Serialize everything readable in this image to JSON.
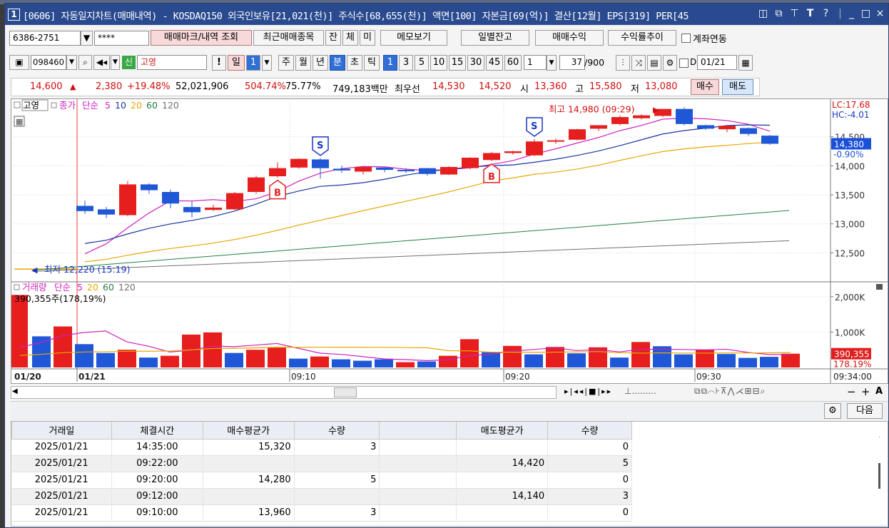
{
  "window": {
    "number": "1",
    "title": "[0606] 자동일지차트(매매내역) - KOSDAQ150 외국인보유[21,021(천)] 주식수[68,655(천)] 액면[100] 자본금[69(억)] 결산[12월] EPS[319] PER[45",
    "controls": [
      "restore",
      "pin",
      "font",
      "help",
      "minimize",
      "maximize",
      "close"
    ]
  },
  "toolbar1": {
    "account": "6386-2751",
    "password": "****",
    "btn_mark": "매매마크/내역 조회",
    "btn_recent": "최근매매종목",
    "btn_jan": "잔",
    "btn_che": "체",
    "btn_mi": "미",
    "btn_memo": "메모보기",
    "btn_daily": "일별잔고",
    "btn_profit": "매매수익",
    "btn_rate": "수익률추이",
    "chk_account": "계좌연동"
  },
  "toolbar2": {
    "code": "098460",
    "badge": "신",
    "stock_name": "고영",
    "periods": [
      "일",
      "1",
      "주",
      "월",
      "년",
      "분",
      "초",
      "틱"
    ],
    "active_period": "분",
    "minutes": [
      "1",
      "3",
      "5",
      "10",
      "15",
      "30",
      "45",
      "60"
    ],
    "active_minute": "1",
    "interval_value": "1",
    "count_value": "37",
    "count_total": "/900",
    "date_value": "01/21",
    "date_checkbox_label": "D"
  },
  "price_bar": {
    "price": "14,600",
    "change": "2,380",
    "change_pct": "+19.48%",
    "volume": "52,021,906",
    "vol_ratio": "504.74%",
    "turnover": "75.77%",
    "amount": "749,183백만",
    "best_label": "최우선",
    "ask": "14,530",
    "bid": "14,520",
    "open_label": "시",
    "open": "13,360",
    "high_label": "고",
    "high": "15,580",
    "low_label": "저",
    "low": "13,080",
    "buy": "매수",
    "sell": "매도"
  },
  "chart_data": [
    {
      "type": "candlestick",
      "title": "고영",
      "legend": [
        "종가",
        "단순",
        "5",
        "10",
        "20",
        "60",
        "120"
      ],
      "legend_colors": [
        "#d020c0",
        "#d020c0",
        "#d020c0",
        "#1a35a0",
        "#e8a800",
        "#208040",
        "#707070"
      ],
      "yticks": [
        "14,500",
        "14,000",
        "13,500",
        "13,000",
        "12,500"
      ],
      "ylim": [
        12050,
        15050
      ],
      "lc": "LC:17.68",
      "hc": "HC:-4.01",
      "current_price": "14,380",
      "current_pct": "-0.90%",
      "high_note": "최고 14,980 (09:29)",
      "low_note": "최저 12,220 (15:19)",
      "candles": [
        {
          "o": 13310,
          "c": 13220,
          "h": 13400,
          "l": 13170
        },
        {
          "o": 13250,
          "c": 13160,
          "h": 13290,
          "l": 13100
        },
        {
          "o": 13150,
          "c": 13680,
          "h": 13740,
          "l": 13130
        },
        {
          "o": 13680,
          "c": 13580,
          "h": 13700,
          "l": 13520
        },
        {
          "o": 13550,
          "c": 13350,
          "h": 13590,
          "l": 13270
        },
        {
          "o": 13290,
          "c": 13200,
          "h": 13390,
          "l": 13110
        },
        {
          "o": 13240,
          "c": 13280,
          "h": 13330,
          "l": 13220
        },
        {
          "o": 13250,
          "c": 13530,
          "h": 13550,
          "l": 13240
        },
        {
          "o": 13550,
          "c": 13800,
          "h": 13830,
          "l": 13520
        },
        {
          "o": 13820,
          "c": 13960,
          "h": 14060,
          "l": 13800
        },
        {
          "o": 13970,
          "c": 14120,
          "h": 14130,
          "l": 13950
        },
        {
          "o": 14110,
          "c": 13960,
          "h": 14130,
          "l": 13780
        },
        {
          "o": 13950,
          "c": 13920,
          "h": 14000,
          "l": 13880
        },
        {
          "o": 13900,
          "c": 13980,
          "h": 13990,
          "l": 13850
        },
        {
          "o": 13970,
          "c": 13930,
          "h": 13980,
          "l": 13890
        },
        {
          "o": 13930,
          "c": 13920,
          "h": 13960,
          "l": 13880
        },
        {
          "o": 13960,
          "c": 13860,
          "h": 13960,
          "l": 13830
        },
        {
          "o": 13850,
          "c": 13980,
          "h": 13990,
          "l": 13840
        },
        {
          "o": 13960,
          "c": 14140,
          "h": 14150,
          "l": 13940
        },
        {
          "o": 14100,
          "c": 14220,
          "h": 14240,
          "l": 14080
        },
        {
          "o": 14220,
          "c": 14250,
          "h": 14260,
          "l": 14190
        },
        {
          "o": 14180,
          "c": 14420,
          "h": 14460,
          "l": 14170
        },
        {
          "o": 14420,
          "c": 14440,
          "h": 14470,
          "l": 14380
        },
        {
          "o": 14450,
          "c": 14630,
          "h": 14640,
          "l": 14440
        },
        {
          "o": 14640,
          "c": 14700,
          "h": 14700,
          "l": 14600
        },
        {
          "o": 14720,
          "c": 14840,
          "h": 14870,
          "l": 14700
        },
        {
          "o": 14820,
          "c": 14870,
          "h": 14890,
          "l": 14800
        },
        {
          "o": 14860,
          "c": 14980,
          "h": 14980,
          "l": 14840
        },
        {
          "o": 14980,
          "c": 14720,
          "h": 15010,
          "l": 14700
        },
        {
          "o": 14700,
          "c": 14640,
          "h": 14710,
          "l": 14620
        },
        {
          "o": 14630,
          "c": 14690,
          "h": 14700,
          "l": 14580
        },
        {
          "o": 14650,
          "c": 14550,
          "h": 14660,
          "l": 14520
        },
        {
          "o": 14520,
          "c": 14380,
          "h": 14530,
          "l": 14360
        }
      ],
      "trade_marks": [
        {
          "type": "B",
          "index": 9
        },
        {
          "type": "S",
          "index": 11
        },
        {
          "type": "B",
          "index": 19
        },
        {
          "type": "S",
          "index": 21
        }
      ]
    },
    {
      "type": "bar",
      "title": "거래량",
      "legend": [
        "거래량",
        "단순",
        "5",
        "20",
        "60",
        "120"
      ],
      "legend_colors": [
        "#d020c0",
        "#d020c0",
        "#d020c0",
        "#e8a800",
        "#208040",
        "#707070"
      ],
      "readout": "390,355주(178,19%)",
      "yticks": [
        "2,000K",
        "1,000K"
      ],
      "ylim": [
        0,
        2300
      ],
      "current_value": "390,355",
      "current_pct": "178.19%",
      "values": [
        2050,
        880,
        1160,
        660,
        410,
        500,
        280,
        330,
        930,
        990,
        410,
        500,
        560,
        250,
        310,
        230,
        190,
        230,
        150,
        170,
        330,
        800,
        430,
        610,
        370,
        580,
        400,
        570,
        280,
        720,
        600,
        370,
        510,
        380,
        270,
        300,
        390
      ],
      "up": [
        true,
        false,
        true,
        false,
        false,
        true,
        false,
        true,
        true,
        true,
        false,
        true,
        true,
        false,
        true,
        false,
        false,
        false,
        true,
        false,
        true,
        true,
        false,
        true,
        false,
        true,
        false,
        true,
        false,
        true,
        false,
        false,
        true,
        false,
        false,
        false,
        true
      ]
    }
  ],
  "time_axis": [
    "01/20",
    "01/21",
    "09:10",
    "09:20",
    "09:30",
    "09:34:00"
  ],
  "side_buttons": {
    "next": "다음"
  },
  "trade_table": {
    "headers": [
      "거래일",
      "체결시간",
      "매수평균가",
      "수량",
      "",
      "매도평균가",
      "수량"
    ],
    "rows": [
      [
        "2025/01/21",
        "14:35:00",
        "15,320",
        "3",
        "",
        "",
        "0"
      ],
      [
        "2025/01/21",
        "09:22:00",
        "",
        "",
        "",
        "14,420",
        "5"
      ],
      [
        "2025/01/21",
        "09:20:00",
        "14,280",
        "5",
        "",
        "",
        "0"
      ],
      [
        "2025/01/21",
        "09:12:00",
        "",
        "",
        "",
        "14,140",
        "3"
      ],
      [
        "2025/01/21",
        "09:10:00",
        "13,960",
        "3",
        "",
        "",
        "0"
      ]
    ]
  }
}
